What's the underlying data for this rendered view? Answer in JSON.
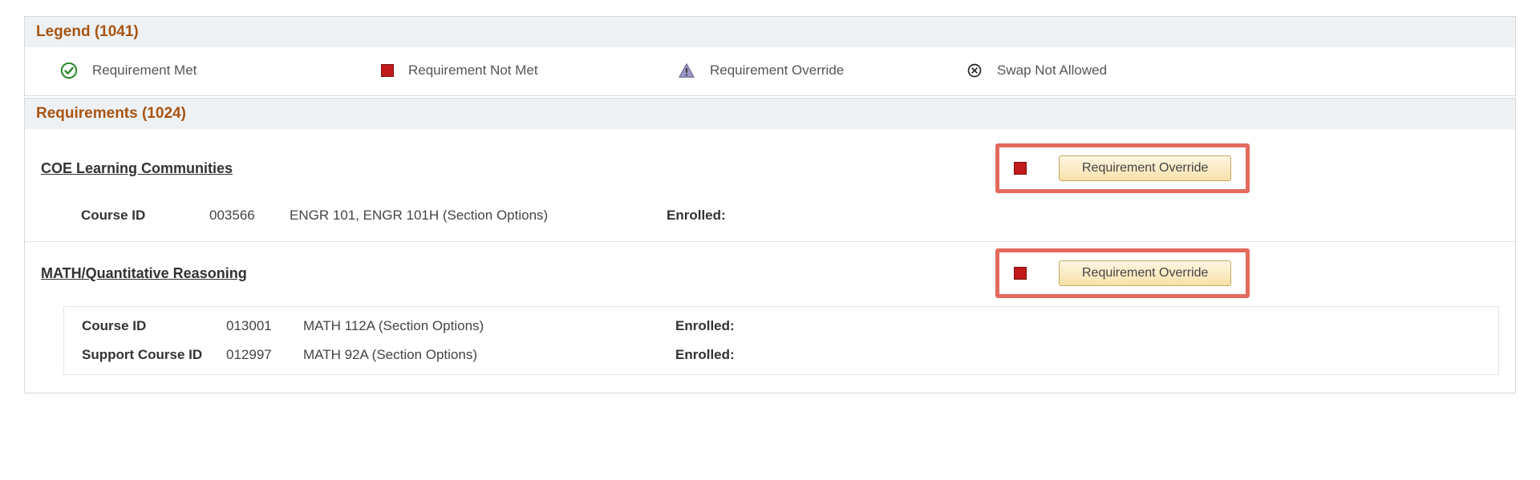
{
  "legend": {
    "title": "Legend (1041)",
    "items": [
      {
        "label": "Requirement Met"
      },
      {
        "label": "Requirement Not Met"
      },
      {
        "label": "Requirement Override"
      },
      {
        "label": "Swap Not Allowed"
      }
    ]
  },
  "requirements": {
    "title": "Requirements (1024)",
    "override_button_label": "Requirement Override",
    "blocks": [
      {
        "title": "COE Learning Communities",
        "rows": [
          {
            "label": "Course ID",
            "id": "003566",
            "desc": "ENGR  101, ENGR  101H (Section Options)",
            "enrolled_label": "Enrolled:"
          }
        ]
      },
      {
        "title": "MATH/Quantitative Reasoning",
        "rows": [
          {
            "label": "Course ID",
            "id": "013001",
            "desc": "MATH  112A (Section Options)",
            "enrolled_label": "Enrolled:"
          },
          {
            "label": "Support Course ID",
            "id": "012997",
            "desc": "MATH  92A (Section Options)",
            "enrolled_label": "Enrolled:"
          }
        ]
      }
    ]
  }
}
